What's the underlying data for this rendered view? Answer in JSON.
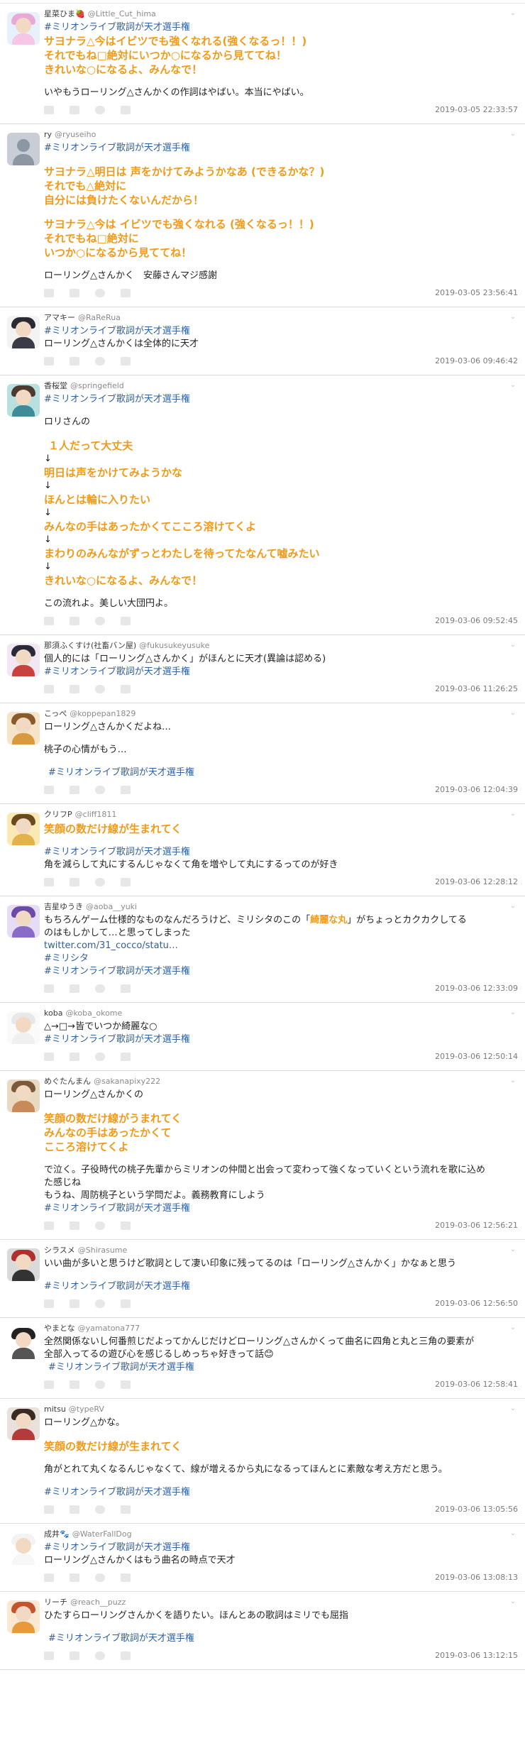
{
  "tweets": [
    {
      "name": "星菜ひま🍓",
      "handle": "@Little_Cut_hima",
      "avatar": {
        "hair": "#e9a9d6",
        "body": "#f4c7e6",
        "bg": "#e8f0fb"
      },
      "lines": [
        {
          "t": "#ミリオンライブ歌詞が天才選手権",
          "k": "tag"
        },
        {
          "t": "サヨナラ△今はイビツでも強くなれる(強くなるっ！！)",
          "k": "hl"
        },
        {
          "t": "それでもね□絶対にいつか○になるから見ててね！",
          "k": "hl"
        },
        {
          "t": "きれいな○になるよ、みんなで！",
          "k": "hl"
        },
        {
          "t": "",
          "k": "blank"
        },
        {
          "t": "いやもうローリング△さんかくの作詞はやばい。本当にやばい。",
          "k": ""
        }
      ],
      "time": "2019-03-05 22:33:57"
    },
    {
      "name": "ry",
      "handle": "@ryuseiho",
      "avatar": {
        "hair": "",
        "body": "",
        "bg": "default"
      },
      "lines": [
        {
          "t": "#ミリオンライブ歌詞が天才選手権",
          "k": "tag"
        },
        {
          "t": "",
          "k": "blank"
        },
        {
          "t": "サヨナラ△明日は 声をかけてみようかなあ (できるかな？)",
          "k": "hl"
        },
        {
          "t": "それでも△絶対に",
          "k": "hl"
        },
        {
          "t": "自分には負けたくないんだから！",
          "k": "hl"
        },
        {
          "t": "",
          "k": "blank"
        },
        {
          "t": "サヨナラ△今は イビツでも強くなれる (強くなるっ！！)",
          "k": "hl"
        },
        {
          "t": "それでもね□絶対に",
          "k": "hl"
        },
        {
          "t": "いつか○になるから見ててね！",
          "k": "hl"
        },
        {
          "t": "",
          "k": "blank"
        },
        {
          "t": "ローリング△さんかく　安藤さんマジ感謝",
          "k": ""
        }
      ],
      "time": "2019-03-05 23:56:41"
    },
    {
      "name": "アマキー",
      "handle": "@RaReRua",
      "avatar": {
        "hair": "#2b2b33",
        "body": "#3b3b48",
        "bg": "#f3f3f3"
      },
      "lines": [
        {
          "t": "#ミリオンライブ歌詞が天才選手権",
          "k": "tag"
        },
        {
          "t": "ローリング△さんかくは全体的に天才",
          "k": ""
        }
      ],
      "time": "2019-03-06 09:46:42"
    },
    {
      "name": "香桜堂",
      "handle": "@springefield",
      "avatar": {
        "hair": "#4e3a2e",
        "body": "#3e8c9a",
        "bg": "#b8e0de"
      },
      "lines": [
        {
          "t": "#ミリオンライブ歌詞が天才選手権",
          "k": "tag"
        },
        {
          "t": "",
          "k": "blank"
        },
        {
          "t": "ロリさんの",
          "k": ""
        },
        {
          "t": "",
          "k": "blank"
        },
        {
          "t": "１人だって大丈夫",
          "k": "hl ind"
        },
        {
          "t": "↓",
          "k": ""
        },
        {
          "t": "明日は声をかけてみようかな",
          "k": "hl"
        },
        {
          "t": "↓",
          "k": ""
        },
        {
          "t": "ほんとは輪に入りたい",
          "k": "hl"
        },
        {
          "t": "↓",
          "k": ""
        },
        {
          "t": "みんなの手はあったかくてこころ溶けてくよ",
          "k": "hl"
        },
        {
          "t": "↓",
          "k": ""
        },
        {
          "t": "まわりのみんながずっとわたしを待ってたなんて嘘みたい",
          "k": "hl"
        },
        {
          "t": "↓",
          "k": ""
        },
        {
          "t": "きれいな○になるよ、みんなで！",
          "k": "hl"
        },
        {
          "t": "",
          "k": "blank"
        },
        {
          "t": "この流れよ。美しい大団円よ。",
          "k": ""
        }
      ],
      "time": "2019-03-06 09:52:45"
    },
    {
      "name": "那須ふくすけ(社畜バン屋)",
      "handle": "@fukusukeyusuke",
      "avatar": {
        "hair": "#2a2a3a",
        "body": "#c9413f",
        "bg": "#f1e6f1"
      },
      "lines": [
        {
          "t": "個人的には「ローリング△さんかく」がほんとに天才(異論は認める)",
          "k": ""
        },
        {
          "t": "#ミリオンライブ歌詞が天才選手権",
          "k": "tag"
        }
      ],
      "time": "2019-03-06 11:26:25"
    },
    {
      "name": "こっぺ",
      "handle": "@koppepan1829",
      "avatar": {
        "hair": "#8b5a2b",
        "body": "#d89a3c",
        "bg": "#f6e4c8"
      },
      "lines": [
        {
          "t": "ローリング△さんかくだよね…",
          "k": ""
        },
        {
          "t": "",
          "k": "blank"
        },
        {
          "t": "桃子の心情がもう…",
          "k": ""
        },
        {
          "t": "",
          "k": "blank"
        },
        {
          "t": "#ミリオンライブ歌詞が天才選手権",
          "k": "tag ind"
        }
      ],
      "time": "2019-03-06 12:04:39"
    },
    {
      "name": "クリフP",
      "handle": "@cliff1811",
      "avatar": {
        "hair": "#6b4b1e",
        "body": "#e3b24a",
        "bg": "#fbe9b5"
      },
      "lines": [
        {
          "t": "笑顔の数だけ線が生まれてく",
          "k": "hl"
        },
        {
          "t": "",
          "k": "blank"
        },
        {
          "t": "#ミリオンライブ歌詞が天才選手権",
          "k": "tag"
        },
        {
          "t": "角を減らして丸にするんじゃなくて角を増やして丸にするってのが好き",
          "k": ""
        }
      ],
      "time": "2019-03-06 12:28:12"
    },
    {
      "name": "吉星ゆうき",
      "handle": "@aoba__yuki",
      "avatar": {
        "hair": "#6b4aa8",
        "body": "#8a6cc8",
        "bg": "#e6dcf6"
      },
      "lines": [
        {
          "t": "もちろんゲーム仕様的なものなんだろうけど、ミリシタのこの「綺麗な丸」がちょっとカクカクしてる",
          "k": "mixed"
        },
        {
          "t": "のはもしかして…と思ってしまった",
          "k": ""
        },
        {
          "t": "twitter.com/31_cocco/statu…",
          "k": "link"
        },
        {
          "t": "#ミリシタ",
          "k": "tag"
        },
        {
          "t": "#ミリオンライブ歌詞が天才選手権",
          "k": "tag"
        }
      ],
      "mark": "綺麗な丸",
      "time": "2019-03-06 12:33:09"
    },
    {
      "name": "koba",
      "handle": "@koba_okome",
      "avatar": {
        "hair": "#e8e8e8",
        "body": "#f0f0f0",
        "bg": "#fafafa"
      },
      "lines": [
        {
          "t": "△→□→皆でいつか綺麗な○",
          "k": ""
        },
        {
          "t": "#ミリオンライブ歌詞が天才選手権",
          "k": "tag"
        }
      ],
      "time": "2019-03-06 12:50:14"
    },
    {
      "name": "めぐたんまん",
      "handle": "@sakanapixy222",
      "avatar": {
        "hair": "#7a5a3a",
        "body": "#c98a5a",
        "bg": "#e9d9c0"
      },
      "lines": [
        {
          "t": "ローリング△さんかくの",
          "k": ""
        },
        {
          "t": "",
          "k": "blank"
        },
        {
          "t": "笑顔の数だけ線がうまれてく",
          "k": "hl"
        },
        {
          "t": "みんなの手はあったかくて",
          "k": "hl"
        },
        {
          "t": "こころ溶けてくよ",
          "k": "hl"
        },
        {
          "t": "",
          "k": "blank"
        },
        {
          "t": "で泣く。子役時代の桃子先輩からミリオンの仲間と出会って変わって強くなっていくという流れを歌に込め",
          "k": ""
        },
        {
          "t": "た感じね",
          "k": ""
        },
        {
          "t": "もうね、周防桃子という学問だよ。義務教育にしよう",
          "k": ""
        },
        {
          "t": "#ミリオンライブ歌詞が天才選手権",
          "k": "tag"
        }
      ],
      "time": "2019-03-06 12:56:21"
    },
    {
      "name": "シラスメ",
      "handle": "@Shirasume",
      "avatar": {
        "hair": "#b0302e",
        "body": "#333333",
        "bg": "#dadada"
      },
      "lines": [
        {
          "t": "いい曲が多いと思うけど歌詞として凄い印象に残ってるのは「ローリング△さんかく」かなぁと思う",
          "k": ""
        },
        {
          "t": "",
          "k": "blank"
        },
        {
          "t": "#ミリオンライブ歌詞が天才選手権",
          "k": "tag"
        }
      ],
      "time": "2019-03-06 12:56:50"
    },
    {
      "name": "やまとな",
      "handle": "@yamatona777",
      "avatar": {
        "hair": "#222222",
        "body": "#555555",
        "bg": "#ffffff"
      },
      "lines": [
        {
          "t": "全然関係ないし何番煎じだよってかんじだけどローリング△さんかくって曲名に四角と丸と三角の要素が",
          "k": ""
        },
        {
          "t": "全部入ってるの遊び心を感じるしめっちゃ好きって話😊",
          "k": ""
        },
        {
          "t": "#ミリオンライブ歌詞が天才選手権",
          "k": "tag ind"
        }
      ],
      "time": "2019-03-06 12:58:41"
    },
    {
      "name": "mitsu",
      "handle": "@typeRV",
      "avatar": {
        "hair": "#3a2a22",
        "body": "#b33b3b",
        "bg": "#e9e2dc"
      },
      "lines": [
        {
          "t": "ローリング△かな。",
          "k": ""
        },
        {
          "t": "",
          "k": "blank"
        },
        {
          "t": "笑顔の数だけ線が生まれてく",
          "k": "hl"
        },
        {
          "t": "",
          "k": "blank"
        },
        {
          "t": "角がとれて丸くなるんじゃなくて、線が増えるから丸になるってほんとに素敵な考え方だと思う。",
          "k": ""
        },
        {
          "t": "",
          "k": "blank"
        },
        {
          "t": "#ミリオンライブ歌詞が天才選手権",
          "k": "tag"
        }
      ],
      "time": "2019-03-06 13:05:56"
    },
    {
      "name": "成井🐾",
      "handle": "@WaterFallDog",
      "avatar": {
        "hair": "#f3f3f3",
        "body": "#f7f7f7",
        "bg": "#ffffff"
      },
      "lines": [
        {
          "t": "#ミリオンライブ歌詞が天才選手権",
          "k": "tag"
        },
        {
          "t": "ローリング△さんかくはもう曲名の時点で天才",
          "k": ""
        }
      ],
      "time": "2019-03-06 13:08:13"
    },
    {
      "name": "リーチ",
      "handle": "@reach__puzz",
      "avatar": {
        "hair": "#c2542e",
        "body": "#e89a3a",
        "bg": "#fbe8d2"
      },
      "lines": [
        {
          "t": "ひたすらローリングさんかくを語りたい。ほんとあの歌詞はミリでも屈指",
          "k": ""
        },
        {
          "t": "",
          "k": "blank"
        },
        {
          "t": "#ミリオンライブ歌詞が天才選手権",
          "k": "tag ind"
        }
      ],
      "time": "2019-03-06 13:12:15"
    }
  ],
  "icons": {
    "caret": "chevron-down-icon",
    "reply": "reply-icon",
    "retweet": "retweet-icon",
    "like": "heart-icon",
    "more": "more-icon"
  }
}
